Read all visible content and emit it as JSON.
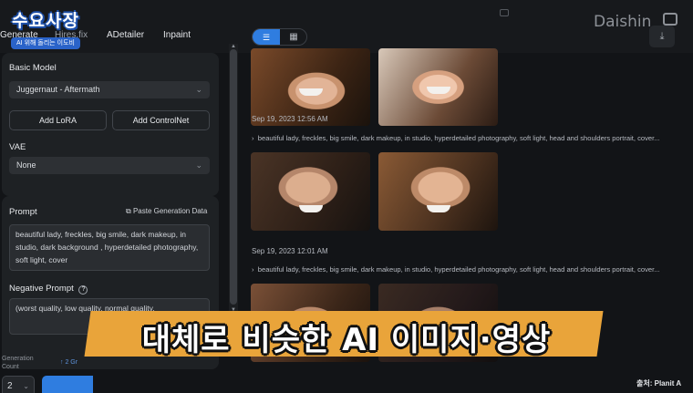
{
  "logo": {
    "title": "수요사장",
    "subtitle": "AI 위해 돌리는 이도비"
  },
  "tabs": [
    {
      "label": "Generate"
    },
    {
      "label": "Hires.fix"
    },
    {
      "label": "ADetailer"
    },
    {
      "label": "Inpaint"
    }
  ],
  "brand": "Daishin",
  "icons": {
    "download": "download-icon",
    "history": "clock-icon",
    "list_view": "list-icon",
    "grid_view": "grid-icon",
    "paste": "clipboard-icon",
    "help": "question-icon"
  },
  "settings": {
    "basic_model_label": "Basic Model",
    "basic_model_value": "Juggernaut - Aftermath",
    "add_lora": "Add LoRA",
    "add_controlnet": "Add ControlNet",
    "vae_label": "VAE",
    "vae_value": "None",
    "prompt_label": "Prompt",
    "paste_label": "Paste Generation Data",
    "prompt_text": "beautiful lady, freckles, big smile, dark makeup, in studio, dark background , hyperdetailed photography, soft light,  cover",
    "negative_label": "Negative Prompt",
    "negative_text": "(worst quality, low quality, normal quality,"
  },
  "bottom": {
    "count_value": "2",
    "count_label": "Generation Count",
    "hint": "↑ 2 Gr"
  },
  "gallery": {
    "groups": [
      {
        "timestamp": "Sep 19, 2023 12:56 AM",
        "prompt": "beautiful lady, freckles, big smile, dark makeup, in studio, hyperdetailed photography, soft light, head and shoulders portrait, cover..."
      },
      {
        "timestamp": "Sep 19, 2023 12:01 AM",
        "prompt": "beautiful lady, freckles, big smile, dark makeup, in studio, hyperdetailed photography, soft light, head and shoulders portrait, cover..."
      }
    ]
  },
  "caption": "대체로 비슷한 AI 이미지·영상",
  "source": "출처: Planit A"
}
